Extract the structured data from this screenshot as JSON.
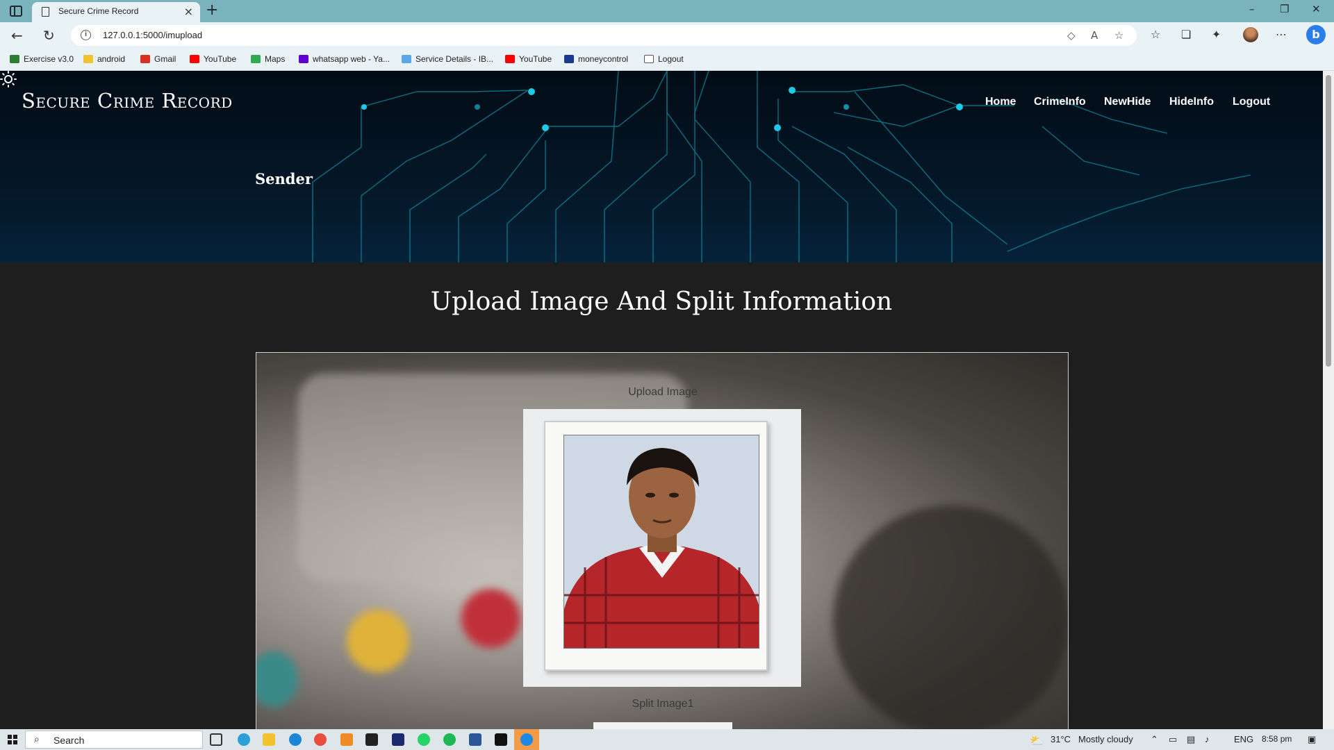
{
  "browser": {
    "tab_title": "Secure Crime Record",
    "url": "127.0.0.1:5000/imupload",
    "bookmarks": [
      {
        "label": "Exercise v3.0",
        "color": "#2e7d32"
      },
      {
        "label": "android",
        "color": "#f2c230"
      },
      {
        "label": "Gmail",
        "color": "#d93025"
      },
      {
        "label": "YouTube",
        "color": "#ff0000"
      },
      {
        "label": "Maps",
        "color": "#34a853"
      },
      {
        "label": "whatsapp web - Ya...",
        "color": "#6001d2"
      },
      {
        "label": "Service Details - IB...",
        "color": "#5aa9e6"
      },
      {
        "label": "YouTube",
        "color": "#ff0000"
      },
      {
        "label": "moneycontrol",
        "color": "#1a3a8f"
      },
      {
        "label": "Logout",
        "color": "#ffffff"
      }
    ]
  },
  "site": {
    "brand": "Secure Crime Record",
    "nav": [
      "Home",
      "CrimeInfo",
      "NewHide",
      "HideInfo",
      "Logout"
    ],
    "section_label": "Sender",
    "heading": "Upload Image And Split Information",
    "upload_label": "Upload Image",
    "split_label": "Split Image1"
  },
  "taskbar": {
    "search_placeholder": "Search",
    "temperature": "31°C",
    "weather": "Mostly cloudy",
    "language": "ENG",
    "time": "8:58 pm"
  },
  "colors": {
    "accent_cyan": "#1ec8e6",
    "hero_bg": "#041727",
    "page_bg": "#1e1e1e"
  }
}
